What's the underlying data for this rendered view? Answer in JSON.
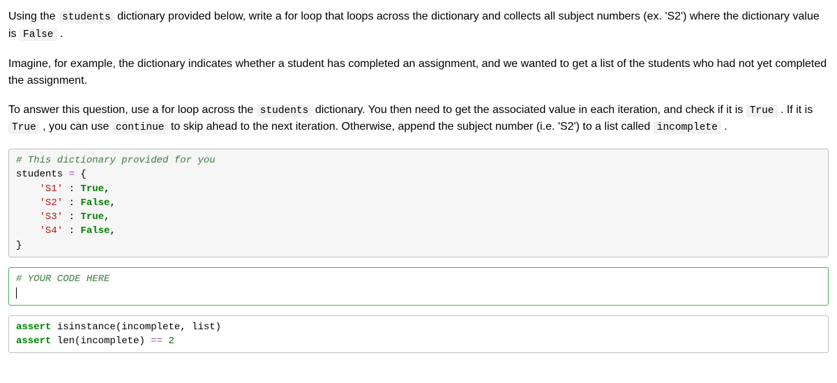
{
  "instructions": {
    "p1_pre": "Using the ",
    "p1_code1": "students",
    "p1_mid": " dictionary provided below, write a for loop that loops across the dictionary and collects all subject numbers (ex. 'S2') where the dictionary value is ",
    "p1_code2": "False",
    "p1_post": " .",
    "p2": "Imagine, for example, the dictionary indicates whether a student has completed an assignment, and we wanted to get a list of the students who had not yet completed the assignment.",
    "p3_pre": "To answer this question, use a for loop across the ",
    "p3_code1": "students",
    "p3_mid1": " dictionary. You then need to get the associated value in each iteration, and check if it is ",
    "p3_code2": "True",
    "p3_mid2": " . If it is ",
    "p3_code3": "True",
    "p3_mid3": " , you can use ",
    "p3_code4": "continue",
    "p3_mid4": " to skip ahead to the next iteration. Otherwise, append the subject number (i.e. 'S2') to a list called ",
    "p3_code5": "incomplete",
    "p3_post": " ."
  },
  "cell1": {
    "comment": "# This dictionary provided for you",
    "line2_a": "students ",
    "line2_op": "=",
    "line2_b": " {",
    "s1_key": "'S1'",
    "s1_sep": " : ",
    "s1_val": "True",
    "s1_comma": ",",
    "s2_key": "'S2'",
    "s2_sep": " : ",
    "s2_val": "False",
    "s2_comma": ",",
    "s3_key": "'S3'",
    "s3_sep": " : ",
    "s3_val": "True",
    "s3_comma": ",",
    "s4_key": "'S4'",
    "s4_sep": " : ",
    "s4_val": "False",
    "s4_comma": ",",
    "close": "}"
  },
  "cell2": {
    "comment": "# YOUR CODE HERE"
  },
  "cell3": {
    "kw_assert1": "assert",
    "l1_mid": " isinstance(incomplete, list)",
    "kw_assert2": "assert",
    "l2_mid": " len(incomplete) ",
    "l2_op": "==",
    "l2_sp": " ",
    "l2_num": "2"
  }
}
